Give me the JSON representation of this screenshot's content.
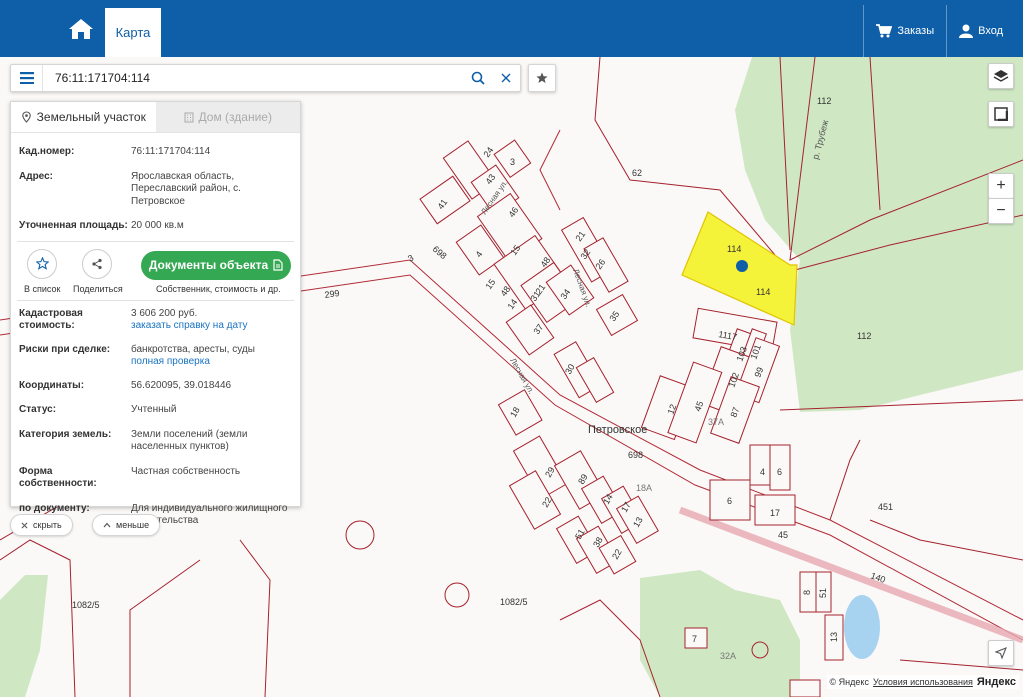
{
  "header": {
    "tab_map": "Карта",
    "orders_label": "Заказы",
    "login_label": "Вход",
    "home_icon": "home-icon",
    "cart_icon": "cart-icon",
    "user_icon": "user-icon"
  },
  "search": {
    "value": "76:11:171704:114"
  },
  "panel": {
    "tab_land": "Земельный участок",
    "tab_house": "Дом (здание)",
    "cad_key": "Кад.номер:",
    "cad_val": "76:11:171704:114",
    "addr_key": "Адрес:",
    "addr_val1": "Ярославская область,",
    "addr_val2": "Переславский район, с. Петровское",
    "area_key": "Уточненная площадь:",
    "area_val": "20 000 кв.м",
    "add_list": "В список",
    "share": "Поделиться",
    "docs_btn": "Документы объекта",
    "docs_sub": "Собственник, стоимость и др.",
    "cost_key1": "Кадастровая",
    "cost_key2": "стоимость:",
    "cost_val": "3 606 200 руб.",
    "cost_link": "заказать справку на дату",
    "risk_key": "Риски при сделке:",
    "risk_val": "банкротства, аресты, суды",
    "risk_link": "полная проверка",
    "coord_key": "Координаты:",
    "coord_val": "56.620095, 39.018446",
    "status_key": "Статус:",
    "status_val": "Учтенный",
    "cat_key": "Категория земель:",
    "cat_val1": "Земли поселений (земли",
    "cat_val2": "населенных пунктов)",
    "own_key": "Форма собственности:",
    "own_val": "Частная собственность",
    "doc_key": "по документу:",
    "doc_val1": "Для индивидуального жилищного",
    "doc_val2": "строительства"
  },
  "buttons": {
    "hide": "скрыть",
    "less": "меньше"
  },
  "map": {
    "village": "Петровское",
    "river": "р. Трубеж",
    "street1": "Лесная ул.",
    "street2": "Лесная ул.",
    "street3": "Лесная ул.",
    "plot_main": "114",
    "plot_main2": "114",
    "labels": {
      "l112a": "112",
      "l112b": "112",
      "l62": "62",
      "l451": "451",
      "l698a": "698",
      "l698b": "698",
      "l299": "299",
      "l1082a": "1082/5",
      "l1082b": "1082/5",
      "l140": "140",
      "l45a": "45",
      "l45b": "45",
      "l24": "24",
      "l3a": "3",
      "l43": "43",
      "l41": "41",
      "l46": "46",
      "l4": "4",
      "l15a": "15",
      "l15b": "15",
      "l48a": "48",
      "l48b": "48",
      "l21a": "21",
      "l21b": "21",
      "l32": "32",
      "l26": "26",
      "l14a": "14",
      "l37": "37",
      "l31": "31",
      "l34": "34",
      "l35": "35",
      "l3b": "3",
      "l1117": "1117",
      "l103": "103",
      "l101": "101",
      "l102": "102",
      "l99": "99",
      "l87": "87",
      "l12": "12",
      "l30": "30",
      "l18": "18",
      "l29": "29",
      "l22a": "22",
      "l89": "89",
      "l14b": "14",
      "l17a": "17",
      "l13a": "13",
      "l51a": "51",
      "l38": "38",
      "l22b": "22",
      "l4b": "4",
      "l6a": "6",
      "l6b": "6",
      "l17b": "17",
      "l8": "8",
      "l51b": "51",
      "l13b": "13",
      "l7": "7",
      "l32a": "32А",
      "l18a": "18А",
      "l37a": "37А"
    }
  },
  "attribution": {
    "copy": "© Яндекс",
    "terms": "Условия использования",
    "brand": "Яндекс"
  }
}
